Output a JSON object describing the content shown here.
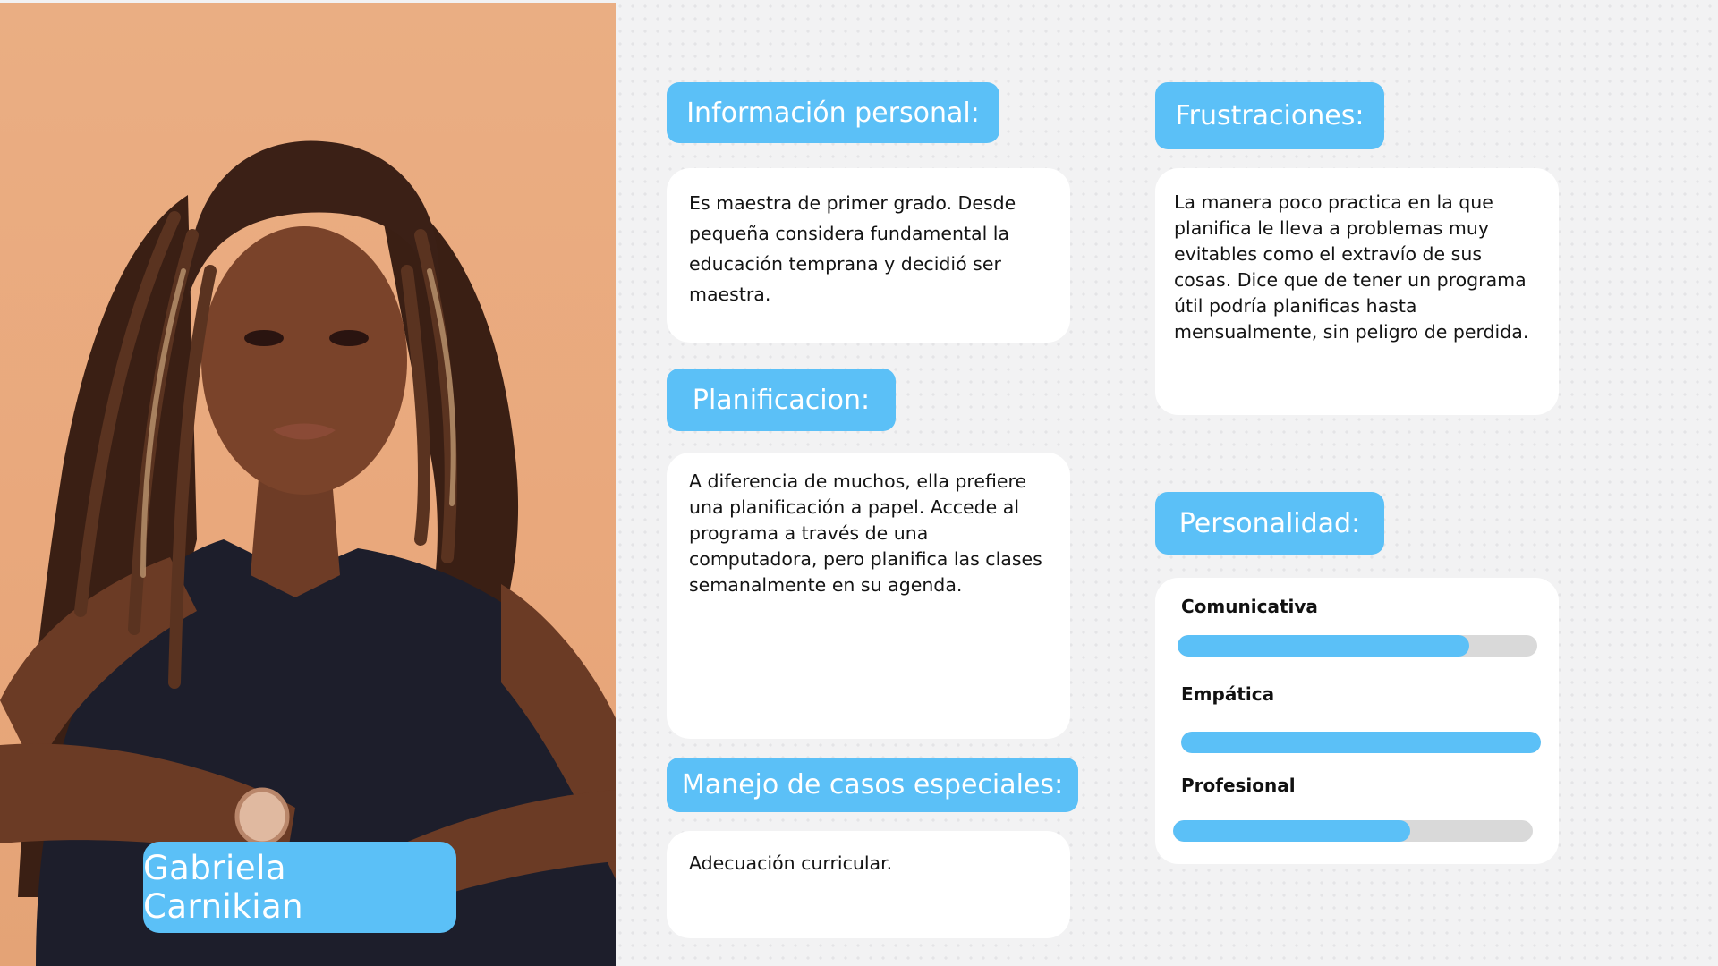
{
  "persona": {
    "name": "Gabriela Carnikian"
  },
  "sections": {
    "info": {
      "title": "Información personal:",
      "text": "Es maestra de primer grado. Desde pequeña considera fundamental la educación temprana y decidió ser maestra."
    },
    "frustrations": {
      "title": "Frustraciones:",
      "text": "La manera poco practica en la que planifica le lleva a problemas muy evitables como el extravío de sus cosas. Dice que de tener un programa útil podría planificas hasta mensualmente, sin peligro de perdida."
    },
    "planning": {
      "title": "Planificacion:",
      "text": "A diferencia de muchos, ella prefiere una planificación a papel. Accede al programa a través de una computadora, pero planifica las clases semanalmente en su agenda."
    },
    "personality": {
      "title": "Personalidad:",
      "traits": [
        {
          "label": "Comunicativa",
          "level": 0.81
        },
        {
          "label": "Empática",
          "level": 1.0
        },
        {
          "label": "Profesional",
          "level": 0.66
        }
      ]
    },
    "special_cases": {
      "title": "Manejo de casos especiales:",
      "text": "Adecuación curricular."
    }
  },
  "colors": {
    "accent": "#5bc0f7",
    "track": "#d9d9d9",
    "photo_background": "#eaae83"
  }
}
